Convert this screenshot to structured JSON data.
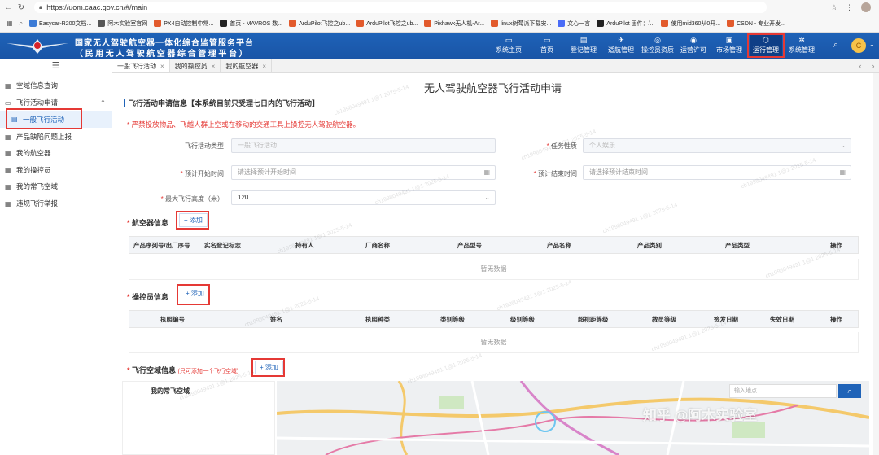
{
  "browser": {
    "url": "https://uom.caac.gov.cn/#/main",
    "bookmarks": [
      "Easycar-R200文档...",
      "阿木实验室官网",
      "PX4自动控制中常...",
      "首页 - MAVROS 数...",
      "ArduPilot飞控之ub...",
      "ArduPilot飞控之ub...",
      "Pixhawk无人机-Ar...",
      "linux树莓派下载安...",
      "文心一言",
      "ArduPilot 固件：/...",
      "使用mid360从0开...",
      "CSDN - 专业开发..."
    ]
  },
  "header": {
    "title_line1": "国家无人驾驶航空器一体化综合监管服务平台",
    "title_line2": "（民用无人驾驶航空器综合管理平台）",
    "menu": [
      {
        "label": "系统主页",
        "icon": "▭"
      },
      {
        "label": "首页",
        "icon": "▭"
      },
      {
        "label": "登记管理",
        "icon": "▤"
      },
      {
        "label": "适航管理",
        "icon": "✈"
      },
      {
        "label": "操控员资质",
        "icon": "◎"
      },
      {
        "label": "运营许可",
        "icon": "◉"
      },
      {
        "label": "市场管理",
        "icon": "▣"
      },
      {
        "label": "运行管理",
        "icon": "⬡"
      },
      {
        "label": "系统管理",
        "icon": "✲"
      }
    ],
    "avatar_initial": "C"
  },
  "sidebar": {
    "items": [
      {
        "label": "空域信息查询"
      },
      {
        "label": "飞行活动申请"
      },
      {
        "label": "一般飞行活动"
      },
      {
        "label": "产品缺陷问题上报"
      },
      {
        "label": "我的航空器"
      },
      {
        "label": "我的操控员"
      },
      {
        "label": "我的常飞空域"
      },
      {
        "label": "违规飞行举报"
      }
    ]
  },
  "tabs": [
    {
      "label": "一般飞行活动"
    },
    {
      "label": "我的操控员"
    },
    {
      "label": "我的航空器"
    }
  ],
  "page": {
    "title": "无人驾驶航空器飞行活动申请",
    "section_apply": "飞行活动申请信息【本系统目前只受理七日内的飞行活动】",
    "warning": "* 严禁投放物品、飞越人群上空或在移动的交通工具上操控无人驾驶航空器。",
    "form": {
      "type_label": "飞行活动类型",
      "type_value": "一般飞行活动",
      "nature_label": "任务性质",
      "nature_value": "个人娱乐",
      "start_label": "预计开始时间",
      "start_placeholder": "请选择预计开始时间",
      "end_label": "预计结束时间",
      "end_placeholder": "请选择预计结束时间",
      "height_label": "最大飞行高度（米）",
      "height_value": "120"
    },
    "aircraft": {
      "title": "航空器信息",
      "add": "+ 添加",
      "columns": [
        "产品序列号/出厂序号",
        "实名登记标志",
        "持有人",
        "厂商名称",
        "产品型号",
        "产品名称",
        "产品类别",
        "产品类型",
        "操作"
      ],
      "empty": "暂无数据"
    },
    "operator": {
      "title": "操控员信息",
      "add": "+ 添加",
      "columns": [
        "执照编号",
        "姓名",
        "执照种类",
        "类别等级",
        "级别等级",
        "超视距等级",
        "教员等级",
        "签发日期",
        "失效日期",
        "操作"
      ],
      "empty": "暂无数据"
    },
    "airspace": {
      "title": "飞行空域信息",
      "note": "(只可添加一个飞行空域)",
      "add": "+ 添加",
      "list_header": "我的常飞空域",
      "search_placeholder": "输入地点",
      "watermark_brand": "知乎 @阿木实验室"
    },
    "watermark": "ch1998049491 1@1 2025-5-14"
  },
  "colors": {
    "primary": "#1f63b8",
    "danger": "#e53935"
  }
}
